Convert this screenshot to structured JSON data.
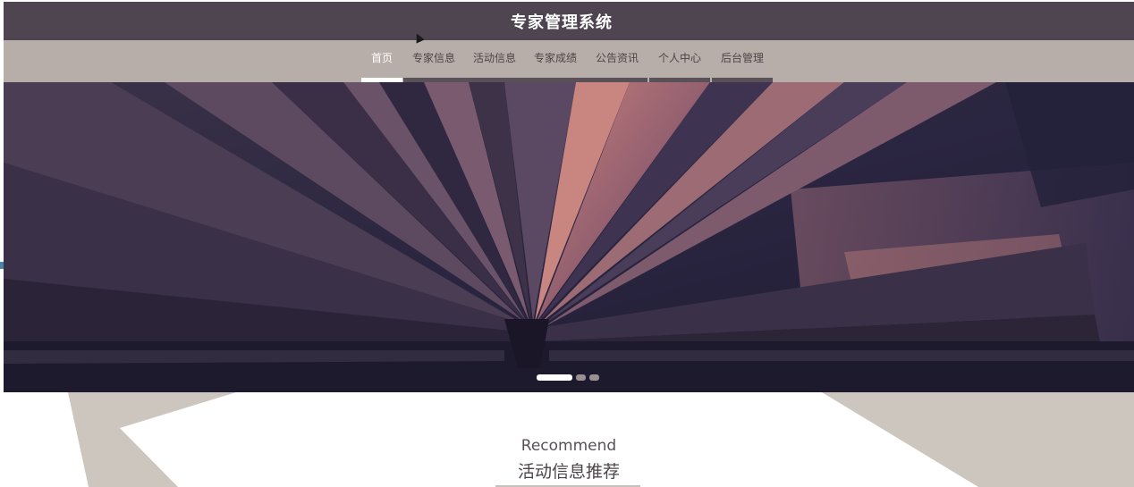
{
  "header": {
    "title": "专家管理系统"
  },
  "nav": {
    "items": [
      {
        "label": "首页",
        "active": true
      },
      {
        "label": "专家信息",
        "active": false
      },
      {
        "label": "活动信息",
        "active": false
      },
      {
        "label": "专家成绩",
        "active": false
      },
      {
        "label": "公告资讯",
        "active": false
      },
      {
        "label": "个人中心",
        "active": false
      },
      {
        "label": "后台管理",
        "active": false
      }
    ]
  },
  "banner": {
    "slide_count": 3,
    "active_slide": 1
  },
  "recommend": {
    "title_en": "Recommend",
    "title_zh": "活动信息推荐"
  },
  "colors": {
    "header_bg": "#4e4551",
    "nav_bg": "#b8aea9",
    "nav_text": "#4d4448",
    "nav_active_text": "#ffffff",
    "decor_shape": "#cdc6bf"
  }
}
